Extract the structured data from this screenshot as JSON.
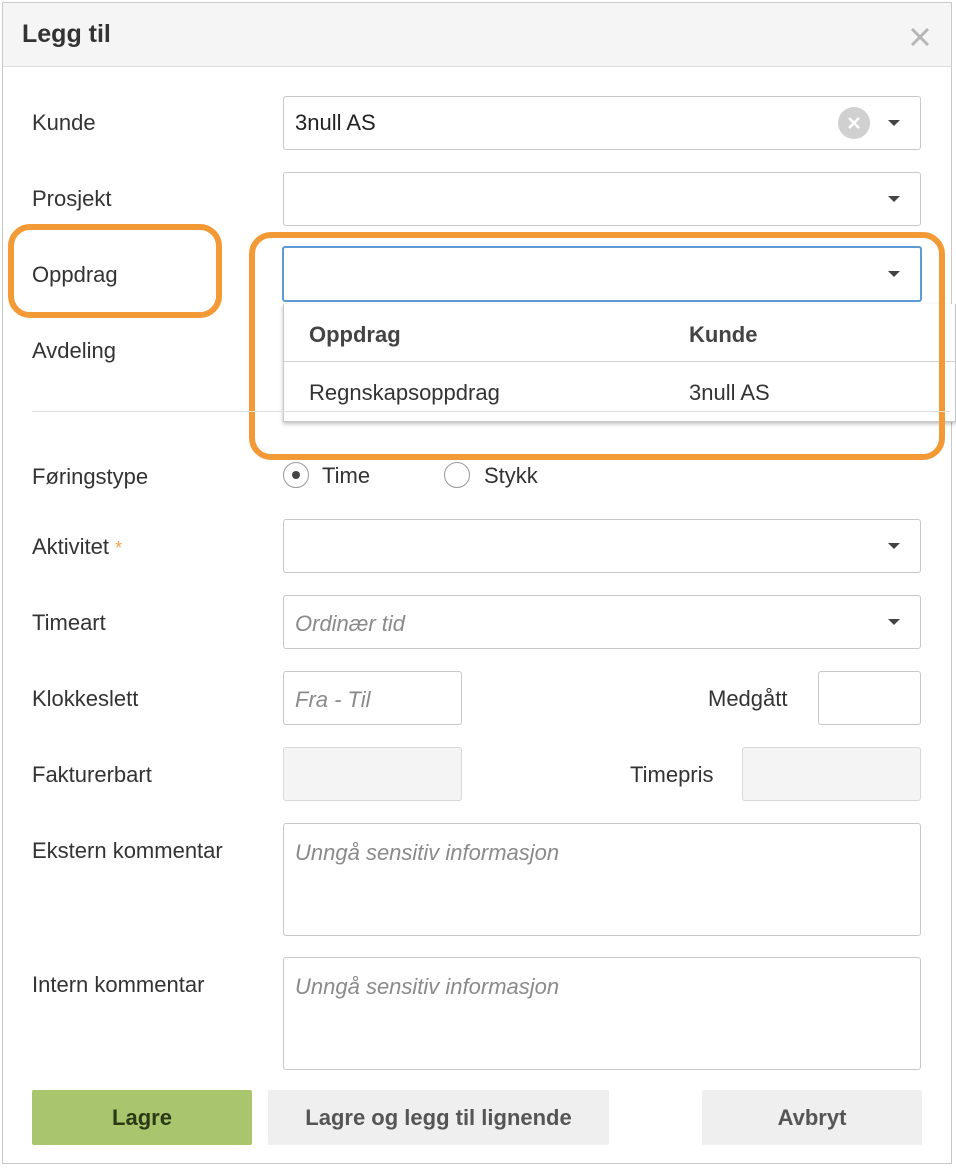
{
  "dialog": {
    "title": "Legg til"
  },
  "fields": {
    "kunde": {
      "label": "Kunde",
      "value": "3null AS"
    },
    "prosjekt": {
      "label": "Prosjekt",
      "value": ""
    },
    "oppdrag": {
      "label": "Oppdrag",
      "value": ""
    },
    "avdeling": {
      "label": "Avdeling"
    },
    "foringstype": {
      "label": "Føringstype",
      "options": [
        "Time",
        "Stykk"
      ],
      "selected": "Time"
    },
    "aktivitet": {
      "label": "Aktivitet",
      "required_mark": "*",
      "value": ""
    },
    "timeart": {
      "label": "Timeart",
      "placeholder": "Ordinær tid"
    },
    "klokkeslett": {
      "label": "Klokkeslett",
      "placeholder": "Fra - Til"
    },
    "medgatt": {
      "label": "Medgått",
      "value": ""
    },
    "fakturerbart": {
      "label": "Fakturerbart",
      "value": ""
    },
    "timepris": {
      "label": "Timepris",
      "value": ""
    },
    "ekstern_kommentar": {
      "label": "Ekstern kommentar",
      "placeholder": "Unngå sensitiv informasjon"
    },
    "intern_kommentar": {
      "label": "Intern kommentar",
      "placeholder": "Unngå sensitiv informasjon"
    }
  },
  "oppdrag_dropdown": {
    "columns": [
      "Oppdrag",
      "Kunde"
    ],
    "rows": [
      {
        "oppdrag": "Regnskapsoppdrag",
        "kunde": "3null AS"
      }
    ]
  },
  "buttons": {
    "save": "Lagre",
    "save_similar": "Lagre og legg til lignende",
    "cancel": "Avbryt"
  },
  "colors": {
    "highlight": "#f39a37",
    "save_button": "#a9c66f",
    "focus_border": "#5b9bd1",
    "required": "#f0a34d"
  },
  "icons": {
    "close": "close-icon",
    "dropdown": "chevron-down-icon",
    "clear": "clear-icon"
  }
}
